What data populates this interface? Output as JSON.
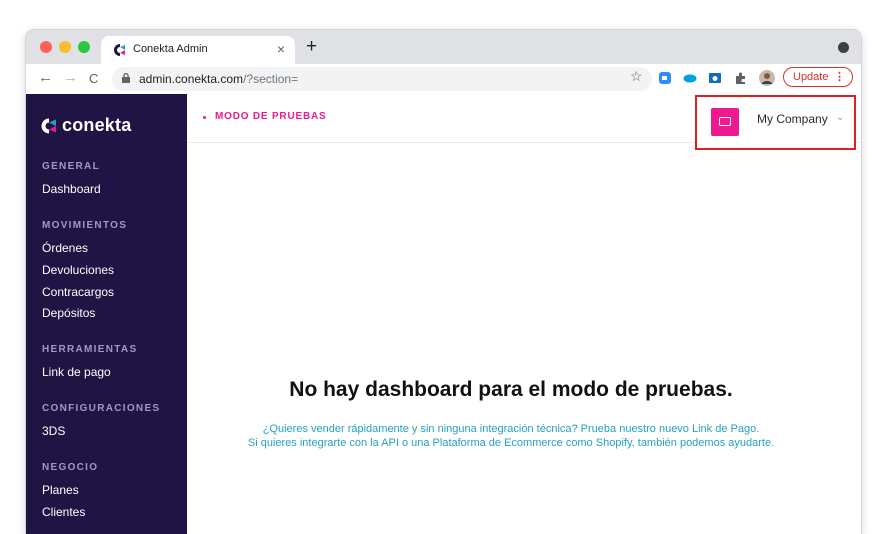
{
  "browser": {
    "tab_title": "Conekta Admin",
    "tab_close": "×",
    "new_tab": "+",
    "nav": {
      "back": "←",
      "forward": "→",
      "reload": "C"
    },
    "url_host": "admin.conekta.com",
    "url_path": "/?section=",
    "star": "☆",
    "update_label": "Update",
    "update_kebab": "⋮"
  },
  "sidebar": {
    "logo": "conekta",
    "sections": [
      {
        "title": "GENERAL",
        "items": [
          "Dashboard"
        ]
      },
      {
        "title": "MOVIMIENTOS",
        "items": [
          "Órdenes",
          "Devoluciones",
          "Contracargos",
          "Depósitos"
        ]
      },
      {
        "title": "HERRAMIENTAS",
        "items": [
          "Link de pago"
        ]
      },
      {
        "title": "CONFIGURACIONES",
        "items": [
          "3DS"
        ]
      },
      {
        "title": "NEGOCIO",
        "items": [
          "Planes",
          "Clientes"
        ]
      }
    ]
  },
  "header": {
    "mode_label": "MODO DE PRUEBAS",
    "company_name": "My Company",
    "company_chevron": "⌄"
  },
  "main": {
    "title": "No hay dashboard para el modo de pruebas.",
    "help_line_1": "¿Quieres vender rápidamente y sin ninguna integración técnica? Prueba nuestro nuevo Link de Pago.",
    "help_line_2": "Si quieres integrarte con la API o una Plataforma de Ecommerce como Shopify, también podemos ayudarte."
  },
  "colors": {
    "sidebar_bg": "#1f1443",
    "accent": "#ec1a8c",
    "highlight_border": "#e02020",
    "link": "#25a0c2"
  }
}
